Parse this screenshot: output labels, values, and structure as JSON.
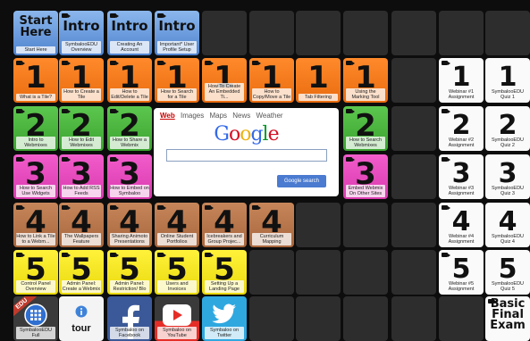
{
  "tiles": [
    {
      "key": "start",
      "color": "blue",
      "big": "Start Here",
      "big_style": "start",
      "label": "Start Here",
      "camera": false
    },
    {
      "key": "intro1",
      "color": "blue",
      "big": "Intro",
      "label": "SymbalooEDU Overview",
      "camera": true
    },
    {
      "key": "intro2",
      "color": "blue",
      "big": "Intro",
      "label": "Creating An Account",
      "camera": true
    },
    {
      "key": "intro3",
      "color": "blue",
      "big": "Intro",
      "label": "Important* User Profile Setup",
      "camera": true
    },
    {
      "key": "o1",
      "color": "orange",
      "big": "1",
      "label": "What is a Tile?",
      "camera": true
    },
    {
      "key": "o2",
      "color": "orange",
      "big": "1",
      "label": "How to Create a Tile",
      "camera": true
    },
    {
      "key": "o3",
      "color": "orange",
      "big": "1",
      "label": "How to Edit/Delete a Tile",
      "camera": true
    },
    {
      "key": "o4",
      "color": "orange",
      "big": "1",
      "label": "How to Search for a Tile",
      "camera": true
    },
    {
      "key": "o5",
      "color": "orange",
      "big": "1",
      "label": "How To Create An Embedded Ti...",
      "camera": true
    },
    {
      "key": "o6",
      "color": "orange",
      "big": "1",
      "label": "How to Copy/Move a Tile",
      "camera": true
    },
    {
      "key": "o7",
      "color": "orange",
      "big": "1",
      "label": "Tab Filtering",
      "camera": false
    },
    {
      "key": "o8",
      "color": "orange",
      "big": "1",
      "label": "Using the Marking Tool",
      "camera": true
    },
    {
      "key": "g1",
      "color": "green",
      "big": "2",
      "label": "Intro to Webmixes",
      "camera": true
    },
    {
      "key": "g2",
      "color": "green",
      "big": "2",
      "label": "How to Edit Webmixes",
      "camera": true
    },
    {
      "key": "g3",
      "color": "green",
      "big": "2",
      "label": "How to Share a Webmix",
      "camera": true
    },
    {
      "key": "g4",
      "color": "green",
      "big": "2",
      "label": "How to Search Webmixes",
      "camera": true
    },
    {
      "key": "p1",
      "color": "pink",
      "big": "3",
      "label": "How to Search Use Widgets",
      "camera": true
    },
    {
      "key": "p2",
      "color": "pink",
      "big": "3",
      "label": "How to Add RSS Feeds",
      "camera": true
    },
    {
      "key": "p3",
      "color": "pink",
      "big": "3",
      "label": "How to Embed on Symbaloo",
      "camera": true
    },
    {
      "key": "p4",
      "color": "pink",
      "big": "3",
      "label": "Embed Webmix On Other Sites",
      "camera": true
    },
    {
      "key": "b1",
      "color": "brown",
      "big": "4",
      "label": "How to Link a Tile to a Webm...",
      "camera": true
    },
    {
      "key": "b2",
      "color": "brown",
      "big": "4",
      "label": "The Wallpapers Feature",
      "camera": true
    },
    {
      "key": "b3",
      "color": "brown",
      "big": "4",
      "label": "Sharing Animoto Presentations",
      "camera": true
    },
    {
      "key": "b4",
      "color": "brown",
      "big": "4",
      "label": "Online Student Portfolios",
      "camera": true
    },
    {
      "key": "b5",
      "color": "brown",
      "big": "4",
      "label": "Icebreakers and Group Projec...",
      "camera": true
    },
    {
      "key": "b6",
      "color": "brown",
      "big": "4",
      "label": "Curriculum Mapping",
      "camera": true
    },
    {
      "key": "y1",
      "color": "yellow",
      "big": "5",
      "label": "Control Panel Overview",
      "camera": true
    },
    {
      "key": "y2",
      "color": "yellow",
      "big": "5",
      "label": "Admin Panel: Create a Webmix",
      "camera": true
    },
    {
      "key": "y3",
      "color": "yellow",
      "big": "5",
      "label": "Admin Panel: Restriction/ Blo",
      "camera": true
    },
    {
      "key": "y4",
      "color": "yellow",
      "big": "5",
      "label": "Users and Invoices",
      "camera": true
    },
    {
      "key": "y5",
      "color": "yellow",
      "big": "5",
      "label": "Setting Up a Landing Page",
      "camera": true
    },
    {
      "key": "w1",
      "color": "white",
      "big": "1",
      "label": "Webinar #1 Assignment",
      "camera": true
    },
    {
      "key": "w2",
      "color": "white",
      "big": "1",
      "label": "SymbalooEDU Quiz 1",
      "camera": false
    },
    {
      "key": "w3",
      "color": "white",
      "big": "2",
      "label": "Webinar #2 Assignment",
      "camera": true
    },
    {
      "key": "w4",
      "color": "white",
      "big": "2",
      "label": "SymbalooEDU Quiz 2",
      "camera": false
    },
    {
      "key": "w5",
      "color": "white",
      "big": "3",
      "label": "Webinar #3 Assignment",
      "camera": true
    },
    {
      "key": "w6",
      "color": "white",
      "big": "3",
      "label": "SymbalooEDU Quiz 3",
      "camera": false
    },
    {
      "key": "w7",
      "color": "white",
      "big": "4",
      "label": "Webinar #4 Assignment",
      "camera": true
    },
    {
      "key": "w8",
      "color": "white",
      "big": "4",
      "label": "SymbalooEDU Quiz 4",
      "camera": false
    },
    {
      "key": "w9",
      "color": "white",
      "big": "5",
      "label": "Webinar #5 Assignment",
      "camera": true
    },
    {
      "key": "w10",
      "color": "white",
      "big": "5",
      "label": "SymbalooEDU Quiz 5",
      "camera": false
    },
    {
      "key": "final",
      "color": "white",
      "big": "Basic Final Exam",
      "big_style": "basic",
      "label": "",
      "camera": true
    },
    {
      "key": "edu",
      "color": "edu",
      "label": "SymbalooEDU Full",
      "badge": "EDU",
      "icon": "grid-icon"
    },
    {
      "key": "tour",
      "color": "tour",
      "label": "tour",
      "icon": "info-icon"
    },
    {
      "key": "fb",
      "color": "facebook",
      "label": "Symbaloo on Facebook",
      "icon": "facebook-icon"
    },
    {
      "key": "yt",
      "color": "youtube",
      "label": "Symbaloo on YouTube",
      "icon": "youtube-icon"
    },
    {
      "key": "tw",
      "color": "twitter",
      "label": "Symbaloo on Twitter",
      "icon": "twitter-icon"
    }
  ],
  "colors": {
    "orange": "#ff7f1e",
    "green": "#4cb841",
    "pink": "#e84bbd",
    "brown": "#b8754a",
    "yellow": "#f5e62a",
    "blue": "#6a9de0",
    "white": "#fafafa",
    "empty": "#2d2d2d",
    "background": "#0d0d0d",
    "facebook": "#3b5998",
    "youtube": "#e52d27",
    "twitter": "#2fa8e0",
    "edu": "#c0392b"
  },
  "google_widget": {
    "tabs": [
      "Web",
      "Images",
      "Maps",
      "News",
      "Weather"
    ],
    "active_tab": "Web",
    "logo": "Google",
    "search_value": "",
    "button_label": "Google search"
  }
}
